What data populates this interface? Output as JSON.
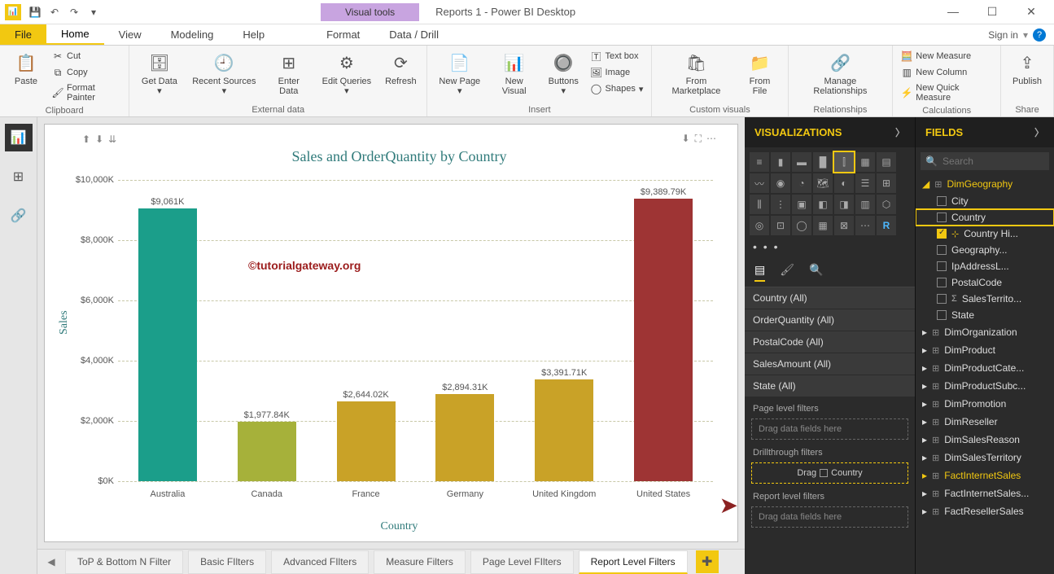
{
  "window": {
    "contextual_tab": "Visual tools",
    "doc_title": "Reports 1 - Power BI Desktop",
    "signin": "Sign in"
  },
  "menu": {
    "file": "File",
    "tabs": [
      "Home",
      "View",
      "Modeling",
      "Help",
      "Format",
      "Data / Drill"
    ],
    "active": "Home"
  },
  "ribbon": {
    "clipboard": {
      "paste": "Paste",
      "cut": "Cut",
      "copy": "Copy",
      "format_painter": "Format Painter",
      "group": "Clipboard"
    },
    "external": {
      "get_data": "Get Data",
      "recent": "Recent Sources",
      "enter": "Enter Data",
      "edit_q": "Edit Queries",
      "refresh": "Refresh",
      "group": "External data"
    },
    "insert": {
      "new_page": "New Page",
      "new_visual": "New Visual",
      "buttons": "Buttons",
      "textbox": "Text box",
      "image": "Image",
      "shapes": "Shapes",
      "group": "Insert"
    },
    "custom": {
      "marketplace": "From Marketplace",
      "file": "From File",
      "group": "Custom visuals"
    },
    "rel": {
      "manage": "Manage Relationships",
      "group": "Relationships"
    },
    "calc": {
      "measure": "New Measure",
      "column": "New Column",
      "quick": "New Quick Measure",
      "group": "Calculations"
    },
    "share": {
      "publish": "Publish",
      "group": "Share"
    }
  },
  "watermark": "©tutorialgateway.org",
  "chart_data": {
    "type": "bar",
    "title": "Sales and OrderQuantity by Country",
    "xlabel": "Country",
    "ylabel": "Sales",
    "ylim": [
      0,
      10000
    ],
    "yticks": [
      "$0K",
      "$2,000K",
      "$4,000K",
      "$6,000K",
      "$8,000K",
      "$10,000K"
    ],
    "categories": [
      "Australia",
      "Canada",
      "France",
      "Germany",
      "United Kingdom",
      "United States"
    ],
    "value_labels": [
      "$9,061K",
      "$1,977.84K",
      "$2,644.02K",
      "$2,894.31K",
      "$3,391.71K",
      "$9,389.79K"
    ],
    "values": [
      9061,
      1977.84,
      2644.02,
      2894.31,
      3391.71,
      9389.79
    ],
    "colors": [
      "#1b9e8a",
      "#a6b13a",
      "#c9a227",
      "#c9a227",
      "#c9a227",
      "#9e3434"
    ]
  },
  "page_tabs": {
    "tabs": [
      "ToP & Bottom N Filter",
      "Basic FIlters",
      "Advanced FIlters",
      "Measure Filters",
      "Page Level FIlters",
      "Report Level Filters"
    ],
    "active_index": 5
  },
  "viz_panel": {
    "title": "VISUALIZATIONS",
    "filters": [
      "Country (All)",
      "OrderQuantity (All)",
      "PostalCode (All)",
      "SalesAmount (All)",
      "State (All)"
    ],
    "page_level": "Page level filters",
    "drag_hint": "Drag data fields here",
    "drillthrough": "Drillthrough filters",
    "drill_drag": "Drag",
    "drill_field": "Country",
    "report_level": "Report level filters"
  },
  "fields_panel": {
    "title": "FIELDS",
    "search_placeholder": "Search",
    "table": "DimGeography",
    "cols": [
      {
        "name": "City",
        "checked": false,
        "highlight": false
      },
      {
        "name": "Country",
        "checked": false,
        "highlight": true
      },
      {
        "name": "Country Hi...",
        "checked": true,
        "highlight": false,
        "hier": true
      },
      {
        "name": "Geography...",
        "checked": false,
        "highlight": false
      },
      {
        "name": "IpAddressL...",
        "checked": false,
        "highlight": false
      },
      {
        "name": "PostalCode",
        "checked": false,
        "highlight": false
      },
      {
        "name": "SalesTerrito...",
        "checked": false,
        "highlight": false,
        "sigma": true
      },
      {
        "name": "State",
        "checked": false,
        "highlight": false
      }
    ],
    "tables": [
      "DimOrganization",
      "DimProduct",
      "DimProductCate...",
      "DimProductSubc...",
      "DimPromotion",
      "DimReseller",
      "DimSalesReason",
      "DimSalesTerritory",
      "FactInternetSales",
      "FactInternetSales...",
      "FactResellerSales"
    ]
  }
}
